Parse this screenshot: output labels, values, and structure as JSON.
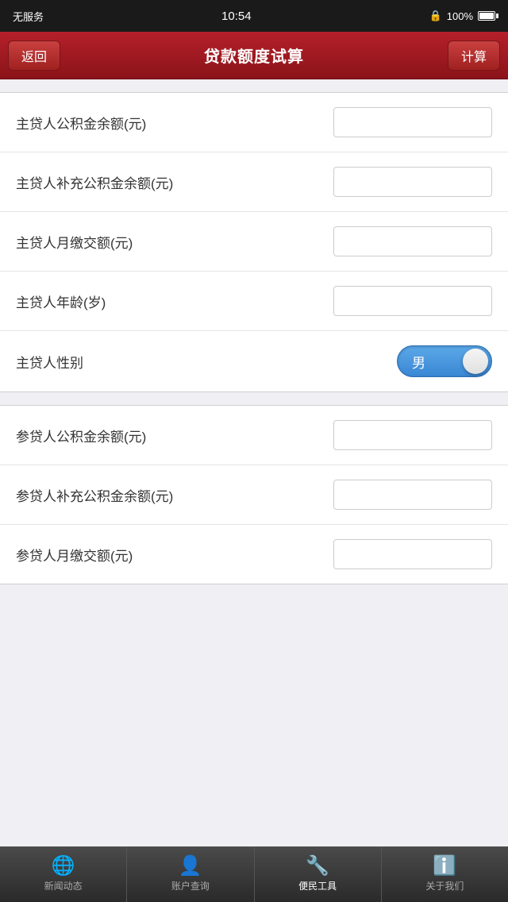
{
  "statusBar": {
    "left": "无服务",
    "time": "10:54",
    "lock": "🔒",
    "battery": "100%"
  },
  "navBar": {
    "backLabel": "返回",
    "title": "贷款额度试算",
    "actionLabel": "计算"
  },
  "mainSection": {
    "rows": [
      {
        "label": "主贷人公积金余额(元)",
        "type": "input",
        "value": "",
        "placeholder": ""
      },
      {
        "label": "主贷人补充公积金余额(元)",
        "type": "input",
        "value": "",
        "placeholder": ""
      },
      {
        "label": "主贷人月缴交额(元)",
        "type": "input",
        "value": "",
        "placeholder": ""
      },
      {
        "label": "主贷人年龄(岁)",
        "type": "input",
        "value": "",
        "placeholder": ""
      },
      {
        "label": "主贷人性别",
        "type": "toggle",
        "toggleValue": "男"
      }
    ]
  },
  "secondSection": {
    "rows": [
      {
        "label": "参贷人公积金余额(元)",
        "type": "input",
        "value": "",
        "placeholder": ""
      },
      {
        "label": "参贷人补充公积金余额(元)",
        "type": "input",
        "value": "",
        "placeholder": ""
      },
      {
        "label": "参贷人月缴交额(元)",
        "type": "input",
        "value": "",
        "placeholder": ""
      }
    ]
  },
  "tabBar": {
    "items": [
      {
        "label": "新闻动态",
        "icon": "🌐",
        "active": false
      },
      {
        "label": "账户查询",
        "icon": "👤",
        "active": false
      },
      {
        "label": "便民工具",
        "icon": "🔧",
        "active": true
      },
      {
        "label": "关于我们",
        "icon": "ℹ️",
        "active": false
      }
    ]
  }
}
